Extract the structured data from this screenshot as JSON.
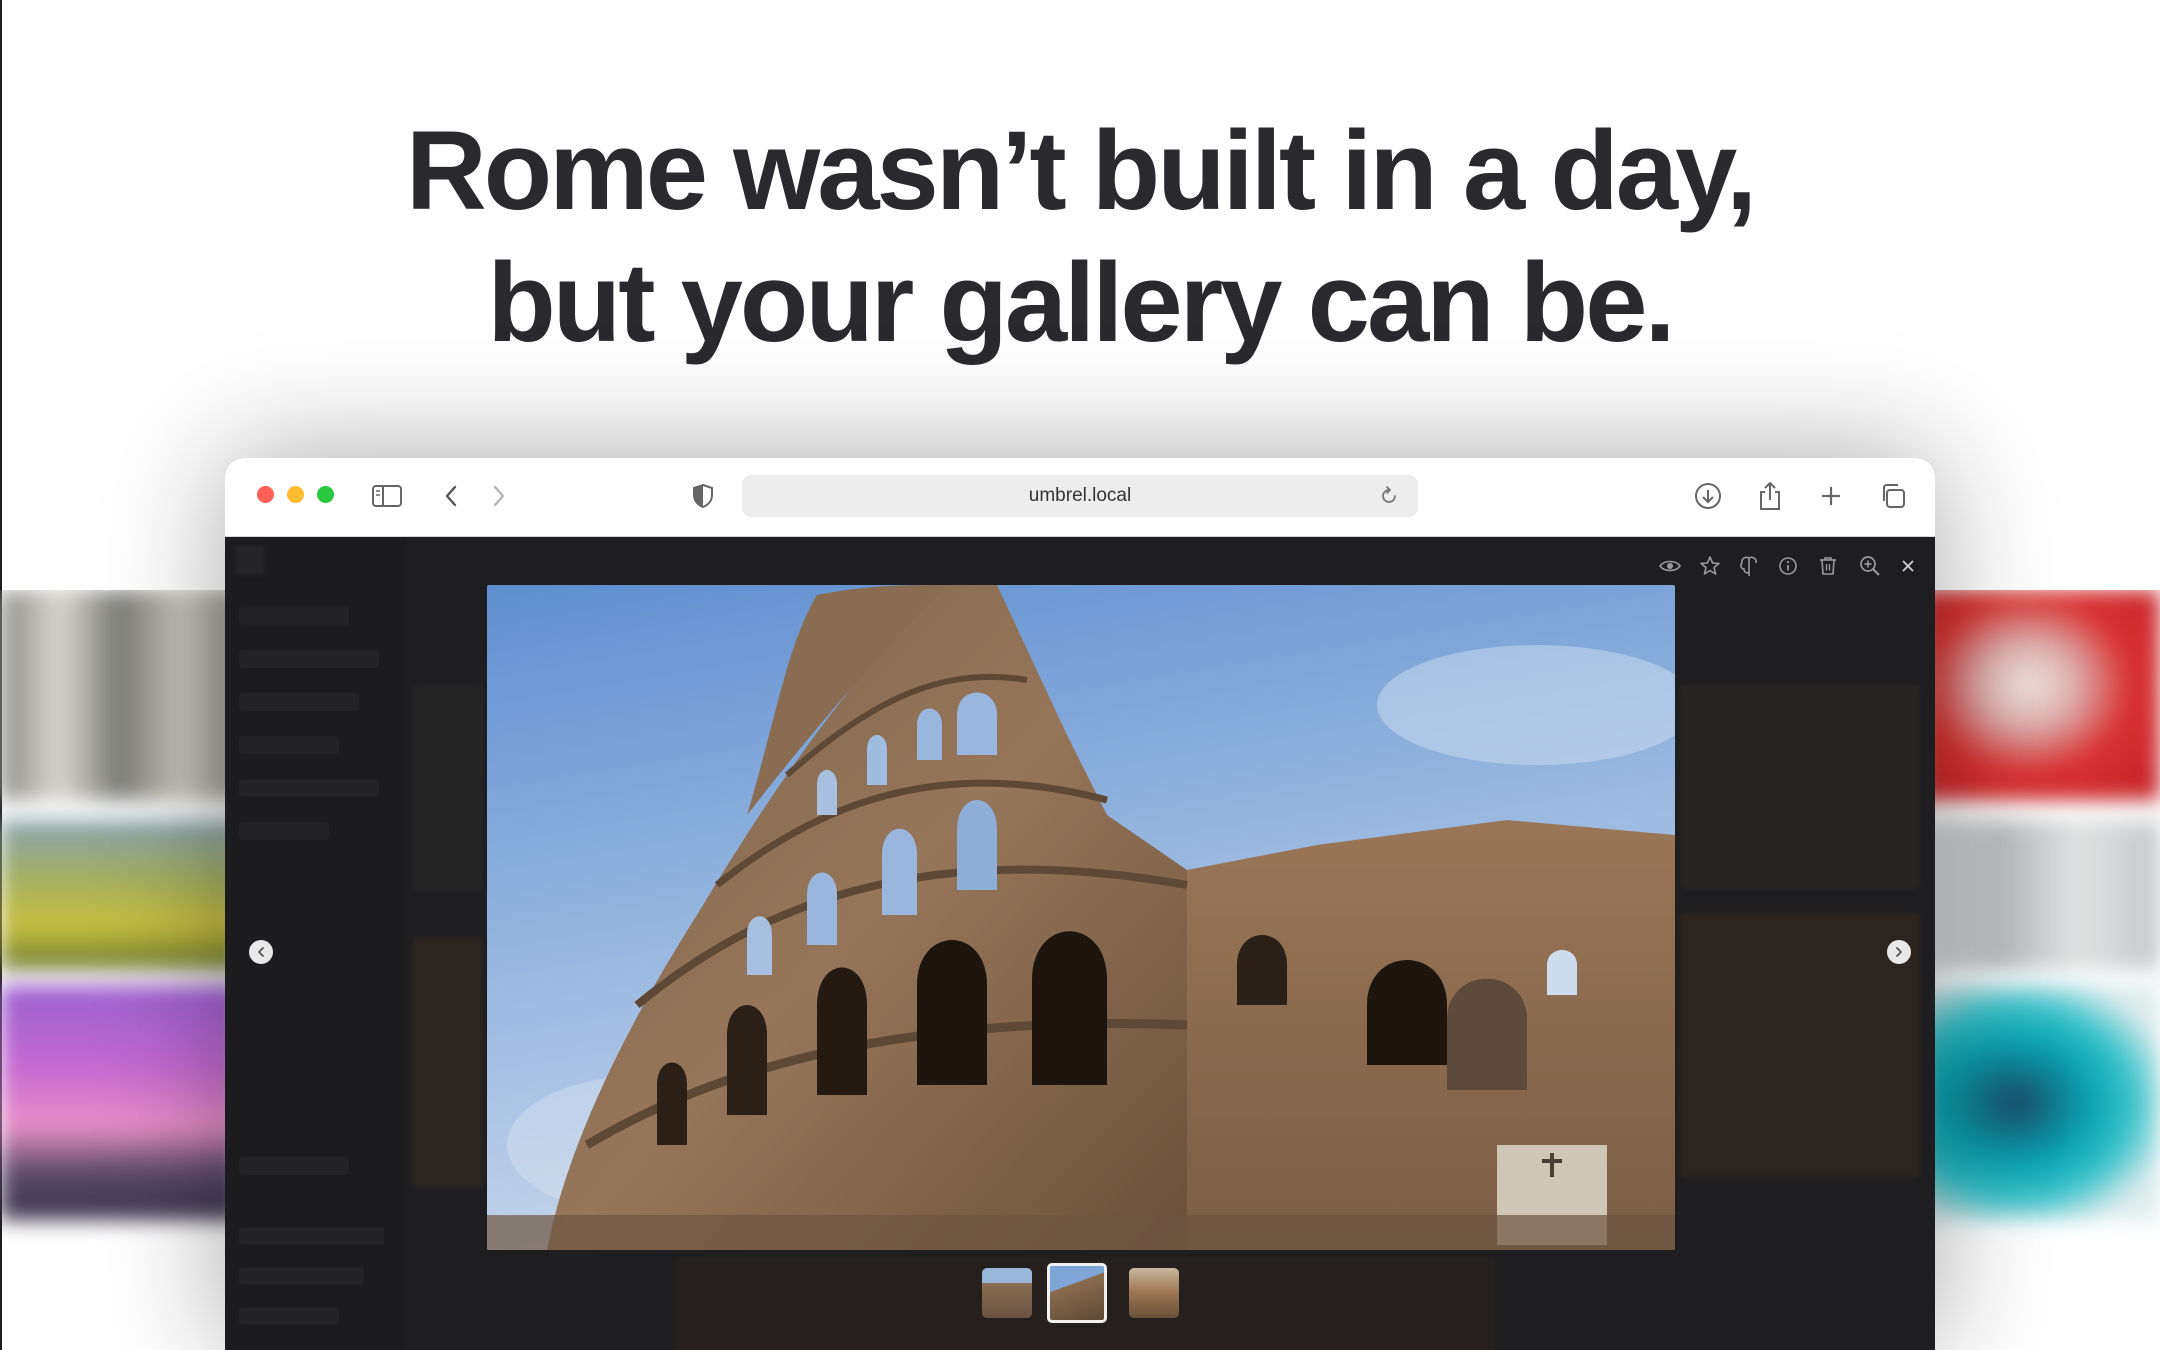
{
  "headline": {
    "line1": "Rome wasn’t built in a day,",
    "line2": "but your gallery can be."
  },
  "browser": {
    "url": "umbrel.local",
    "traffic_lights": {
      "close": "#ff5f57",
      "minimize": "#febc2e",
      "zoom": "#28c840"
    },
    "toolbar_icons": [
      "sidebar-icon",
      "back-icon",
      "forward-icon",
      "shield-icon",
      "reload-icon",
      "download-icon",
      "share-icon",
      "new-tab-icon",
      "tabs-overview-icon"
    ]
  },
  "viewer": {
    "toolbar_icons": [
      "eye-icon",
      "star-icon",
      "brain-icon",
      "info-icon",
      "trash-icon",
      "zoom-in-icon",
      "close-icon"
    ],
    "thumbnails": [
      {
        "name": "arch-thumbnail",
        "active": false
      },
      {
        "name": "colosseum-thumbnail",
        "active": true
      },
      {
        "name": "ruins-thumbnail",
        "active": false
      }
    ]
  },
  "colors": {
    "headline": "#2a2a2e",
    "viewer_background": "#2b2b2d",
    "sky_top": "#6f9bd8",
    "stone": "#8a6a4e"
  }
}
